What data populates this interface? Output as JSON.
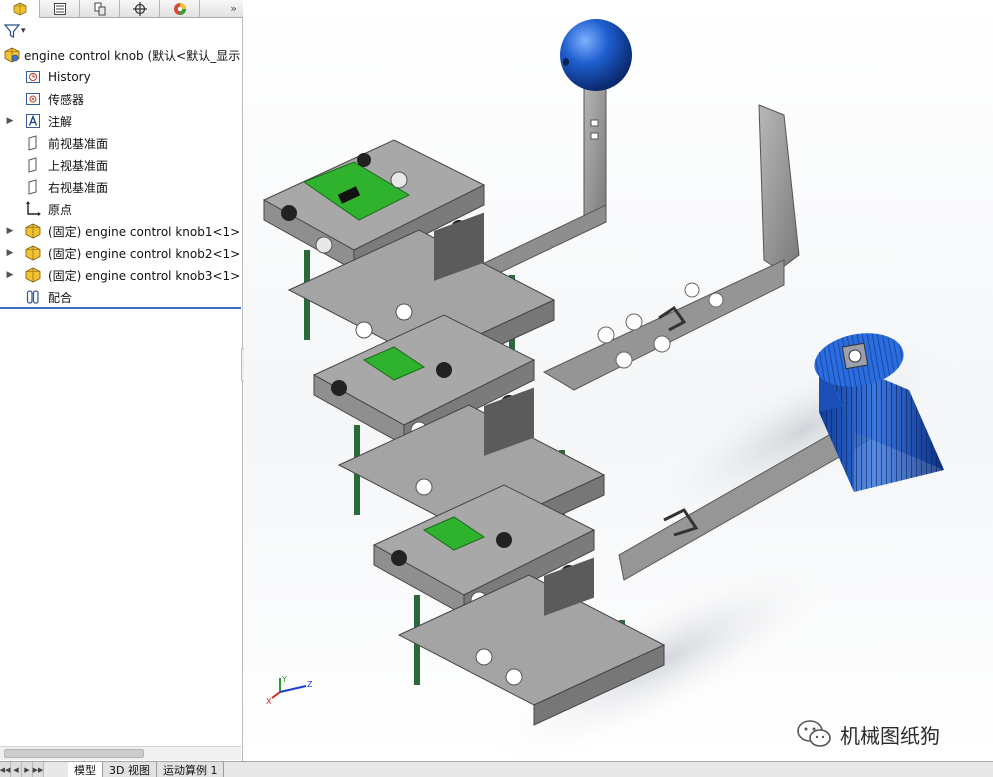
{
  "panel_tabs": [
    {
      "icon": "feature-manager-icon",
      "active": true
    },
    {
      "icon": "property-manager-icon",
      "active": false
    },
    {
      "icon": "configuration-manager-icon",
      "active": false
    },
    {
      "icon": "dimxpert-manager-icon",
      "active": false
    },
    {
      "icon": "display-manager-icon",
      "active": false
    }
  ],
  "panel_more": "»",
  "filter": {
    "icon": "filter-icon",
    "dropdown": "▾"
  },
  "tree": {
    "root": "engine control knob  (默认<默认_显示",
    "items": [
      {
        "label": "History",
        "icon": "history-icon",
        "expandable": false
      },
      {
        "label": "传感器",
        "icon": "sensor-icon",
        "expandable": false
      },
      {
        "label": "注解",
        "icon": "annotation-icon",
        "expandable": true
      },
      {
        "label": "前视基准面",
        "icon": "plane-icon",
        "expandable": false
      },
      {
        "label": "上视基准面",
        "icon": "plane-icon",
        "expandable": false
      },
      {
        "label": "右视基准面",
        "icon": "plane-icon",
        "expandable": false
      },
      {
        "label": "原点",
        "icon": "origin-icon",
        "expandable": false
      },
      {
        "label": "(固定) engine control knob1<1> (",
        "icon": "part-icon",
        "expandable": true
      },
      {
        "label": "(固定) engine control knob2<1> (",
        "icon": "part-icon",
        "expandable": true
      },
      {
        "label": "(固定) engine control knob3<1> (",
        "icon": "part-icon",
        "expandable": true
      },
      {
        "label": "配合",
        "icon": "mates-icon",
        "expandable": false
      }
    ]
  },
  "bottom_tabs": [
    {
      "label": "模型",
      "active": true
    },
    {
      "label": "3D 视图",
      "active": false
    },
    {
      "label": "运动算例 1",
      "active": false
    }
  ],
  "nav_buttons": [
    "◀◀",
    "◀",
    "▶",
    "▶▶"
  ],
  "triad": {
    "x": "X",
    "y": "Y",
    "z": "Z"
  },
  "watermark": "机械图纸狗",
  "colors": {
    "metal": "#9a9a9a",
    "pcb": "#2fb32f",
    "knob_blue": "#1f5fcf",
    "standoff": "#2a6a3a",
    "tree_selection": "#3c6fbf"
  }
}
